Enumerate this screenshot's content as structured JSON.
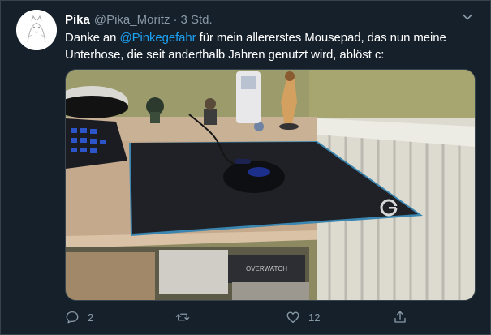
{
  "tweet": {
    "display_name": "Pika",
    "handle": "@Pika_Moritz",
    "separator": "·",
    "time": "3 Std.",
    "text_before": "Danke an ",
    "mention": "@Pinkegefahr",
    "text_after": " für mein allererstes Mousepad, das nun meine Unterhose, die seit anderthalb Jahren genutzt wird, ablöst c:",
    "media": {
      "box_label": "OVERWATCH",
      "pad_logo": "G"
    }
  },
  "actions": {
    "reply_count": "2",
    "retweet_count": "",
    "like_count": "12"
  },
  "icons": {
    "caret": "chevron-down-icon",
    "reply": "reply-icon",
    "retweet": "retweet-icon",
    "like": "heart-icon",
    "share": "share-icon"
  },
  "colors": {
    "background": "#15202b",
    "text": "#ffffff",
    "muted": "#8899a6",
    "link": "#1da1f2"
  }
}
